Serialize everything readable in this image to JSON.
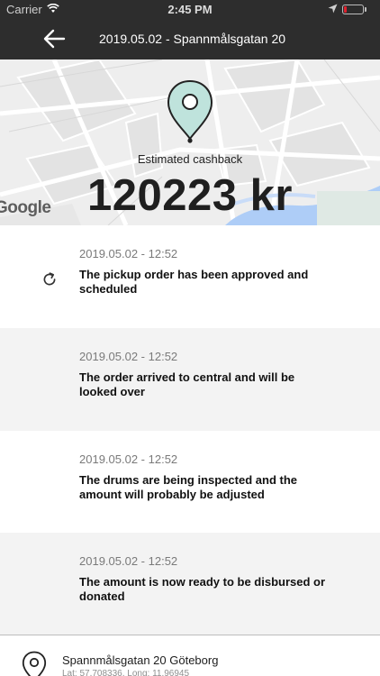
{
  "status_bar": {
    "carrier": "Carrier",
    "time": "2:45 PM",
    "battery_color": "#e0212e"
  },
  "nav": {
    "back_icon": "arrow-left-icon",
    "title": "2019.05.02 - Spannmålsgatan 20"
  },
  "summary": {
    "map_pin_color": "#bfe3dc",
    "caption": "Estimated cashback",
    "amount": "120223 kr",
    "map_attribution": "Google"
  },
  "timeline": [
    {
      "date": "2019.05.02 - 12:52",
      "text": "The pickup order has been approved and scheduled",
      "icon": "refresh-icon",
      "background": "#ffffff"
    },
    {
      "date": "2019.05.02 - 12:52",
      "text": "The order arrived to central and will be looked over",
      "icon": "",
      "background": "#f3f3f3"
    },
    {
      "date": "2019.05.02 - 12:52",
      "text": "The drums are being inspected and the amount will probably be adjusted",
      "icon": "",
      "background": "#ffffff"
    },
    {
      "date": "2019.05.02 - 12:52",
      "text": "The amount is now ready to be disbursed or donated",
      "icon": "",
      "background": "#f3f3f3"
    }
  ],
  "footer": {
    "icon": "map-pin-icon",
    "address": "Spannmålsgatan 20 Göteborg",
    "coordinates": "Lat: 57.708336, Long: 11.96945"
  }
}
